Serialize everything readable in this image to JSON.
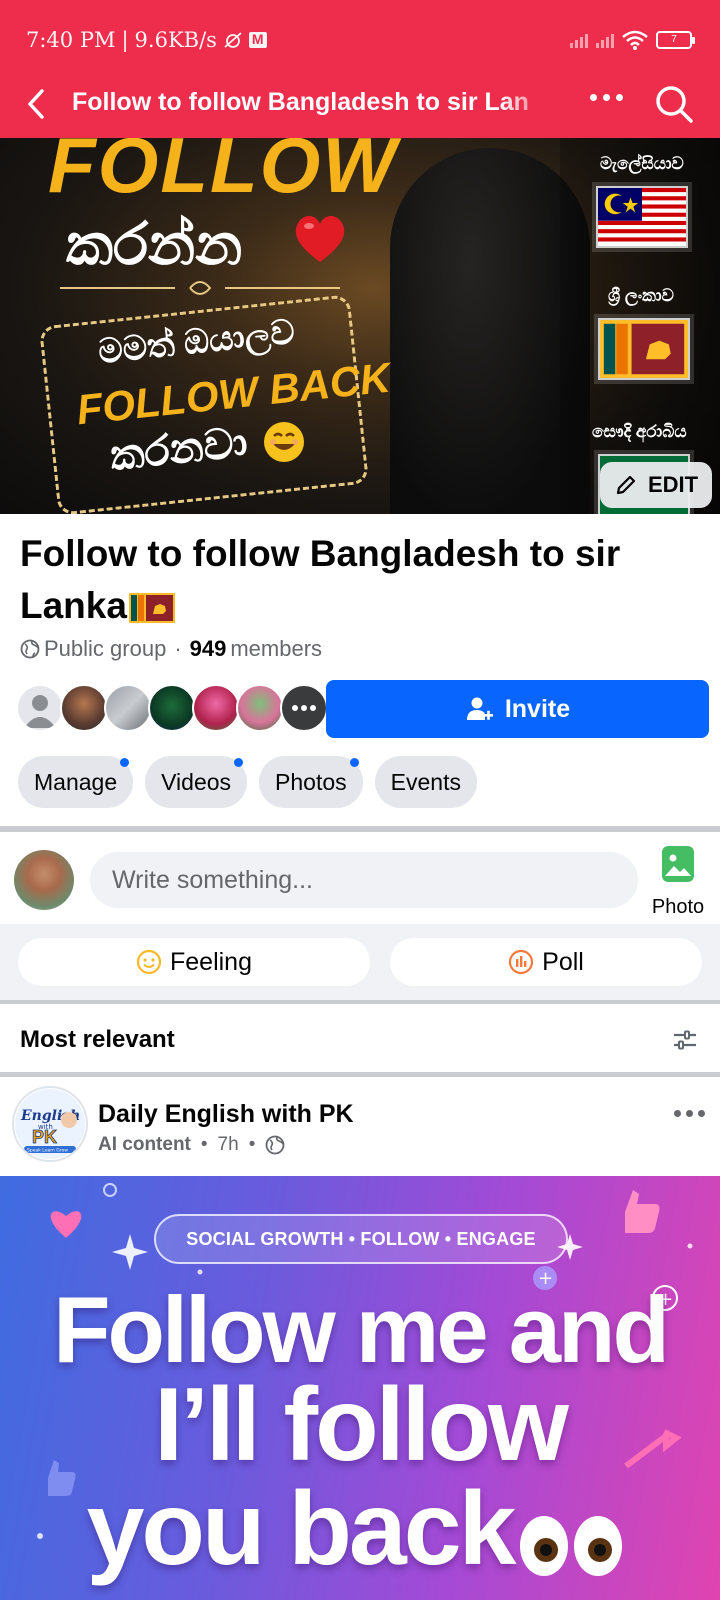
{
  "status_bar": {
    "time": "7:40 PM",
    "separator": "|",
    "speed": "9.6KB/s",
    "battery": "7"
  },
  "app_bar": {
    "title": "Follow to follow  Bangladesh to sir Lan"
  },
  "cover": {
    "headline": "FOLLOW",
    "line_karanna": "කරන්න",
    "box_line1": "මමත් ඔයාලව",
    "box_line2": "FOLLOW BACK",
    "box_line3": "කරනවා",
    "flags": [
      {
        "label": "මැලේසියාව",
        "country": "Malaysia"
      },
      {
        "label": "ශ්‍රී ලංකාව",
        "country": "Sri Lanka"
      },
      {
        "label": "සෞදි අරාබිය",
        "country": "Saudi Arabia"
      }
    ],
    "edit_label": "EDIT"
  },
  "group": {
    "title_line1": "Follow to follow  Bangladesh to sir",
    "title_line2": "Lanka",
    "privacy": "Public group",
    "dot": "·",
    "member_count": "949",
    "members_label": "members",
    "invite_label": "Invite",
    "chips": [
      {
        "label": "Manage",
        "has_dot": true
      },
      {
        "label": "Videos",
        "has_dot": true
      },
      {
        "label": "Photos",
        "has_dot": true
      },
      {
        "label": "Events",
        "has_dot": false
      }
    ]
  },
  "composer": {
    "placeholder": "Write something...",
    "photo_label": "Photo",
    "feeling_label": "Feeling",
    "poll_label": "Poll"
  },
  "feed": {
    "sort_label": "Most relevant"
  },
  "post": {
    "author": "Daily English with PK",
    "tag": "AI content",
    "time": "7h",
    "bullet": "•",
    "avatar_text": {
      "english": "English",
      "with": "with",
      "pk": "PK",
      "badges": "Speak  Learn  Grow"
    },
    "image": {
      "pill_text": "SOCIAL GROWTH • FOLLOW • ENGAGE",
      "line1": "Follow me and",
      "line2": "I’ll follow",
      "line3": "you back"
    }
  },
  "colors": {
    "topbar": "#ee2d4c",
    "fb_blue": "#0866ff",
    "chip_bg": "#e4e6eb",
    "muted_text": "#65676b"
  }
}
